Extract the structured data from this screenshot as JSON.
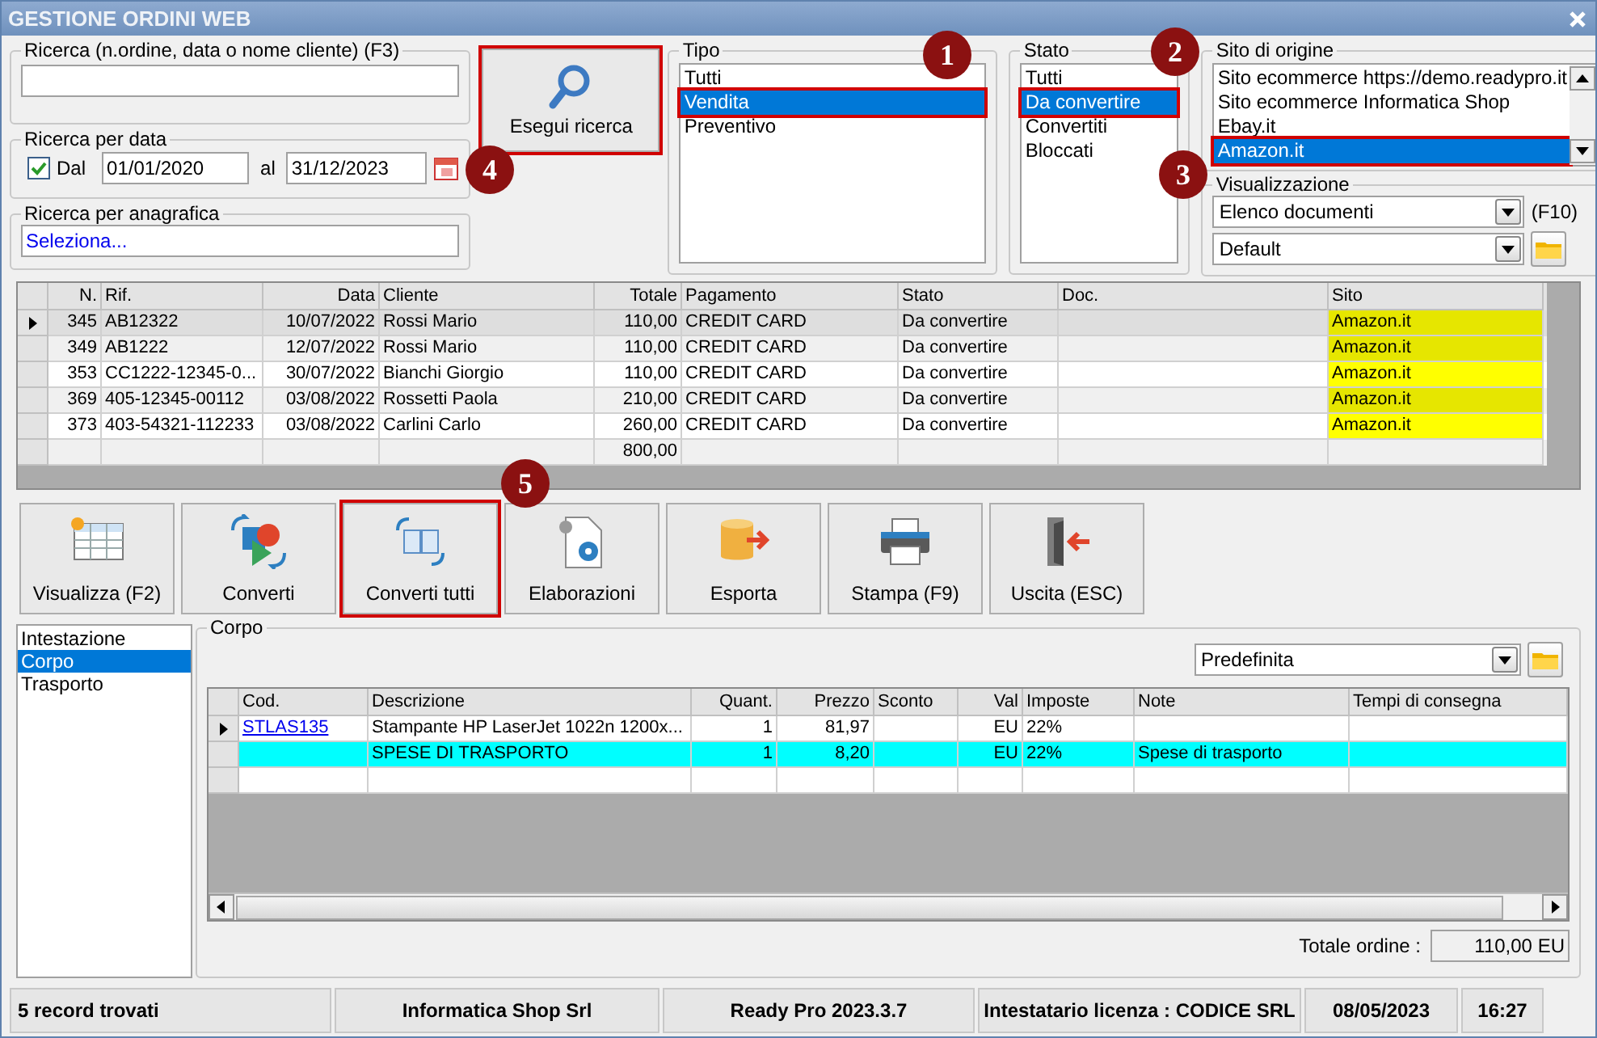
{
  "window": {
    "title": "GESTIONE ORDINI WEB"
  },
  "search": {
    "label": "Ricerca (n.ordine, data o nome cliente) (F3)"
  },
  "date_search": {
    "label": "Ricerca per data",
    "enabled": true,
    "from_label": "Dal",
    "from": "01/01/2020",
    "to_label": "al",
    "to": "31/12/2023"
  },
  "registry_search": {
    "label": "Ricerca per anagrafica",
    "value": "Seleziona..."
  },
  "search_button": {
    "label": "Esegui ricerca",
    "highlighted": true
  },
  "tipo": {
    "label": "Tipo",
    "items": [
      {
        "label": "Tutti",
        "selected": false,
        "highlighted": false
      },
      {
        "label": "Vendita",
        "selected": true,
        "highlighted": true
      },
      {
        "label": "Preventivo",
        "selected": false,
        "highlighted": false
      }
    ]
  },
  "stato": {
    "label": "Stato",
    "items": [
      {
        "label": "Tutti",
        "selected": false,
        "highlighted": false
      },
      {
        "label": "Da convertire",
        "selected": true,
        "highlighted": true
      },
      {
        "label": "Convertiti",
        "selected": false,
        "highlighted": false
      },
      {
        "label": "Bloccati",
        "selected": false,
        "highlighted": false
      }
    ]
  },
  "sito": {
    "label": "Sito di origine",
    "items": [
      {
        "label": "Sito ecommerce https://demo.readypro.it",
        "selected": false,
        "highlighted": false
      },
      {
        "label": "Sito ecommerce Informatica Shop",
        "selected": false,
        "highlighted": false
      },
      {
        "label": "Ebay.it",
        "selected": false,
        "highlighted": false
      },
      {
        "label": "Amazon.it",
        "selected": true,
        "highlighted": true
      }
    ]
  },
  "visualizzazione": {
    "label": "Visualizzazione",
    "view": "Elenco documenti",
    "shortcut": "(F10)",
    "layout": "Default"
  },
  "orders": {
    "columns": [
      "N.",
      "Rif.",
      "Data",
      "Cliente",
      "Totale",
      "Pagamento",
      "Stato",
      "Doc.",
      "Sito"
    ],
    "rows": [
      {
        "cells": [
          "345",
          "AB12322",
          "10/07/2022",
          "Rossi Mario",
          "110,00",
          "CREDIT CARD",
          "Da convertire",
          "",
          "Amazon.it"
        ],
        "current": true
      },
      {
        "cells": [
          "349",
          "AB1222",
          "12/07/2022",
          "Rossi Mario",
          "110,00",
          "CREDIT CARD",
          "Da convertire",
          "",
          "Amazon.it"
        ],
        "current": false
      },
      {
        "cells": [
          "353",
          "CC1222-12345-0...",
          "30/07/2022",
          "Bianchi Giorgio",
          "110,00",
          "CREDIT CARD",
          "Da convertire",
          "",
          "Amazon.it"
        ],
        "current": false
      },
      {
        "cells": [
          "369",
          "405-12345-00112",
          "03/08/2022",
          "Rossetti Paola",
          "210,00",
          "CREDIT CARD",
          "Da convertire",
          "",
          "Amazon.it"
        ],
        "current": false
      },
      {
        "cells": [
          "373",
          "403-54321-112233",
          "03/08/2022",
          "Carlini Carlo",
          "260,00",
          "CREDIT CARD",
          "Da convertire",
          "",
          "Amazon.it"
        ],
        "current": false
      }
    ],
    "total": "800,00"
  },
  "toolbar": [
    {
      "label": "Visualizza (F2)",
      "kind": "view",
      "highlighted": false
    },
    {
      "label": "Converti",
      "kind": "convert",
      "highlighted": false
    },
    {
      "label": "Converti tutti",
      "kind": "convert_all",
      "highlighted": true
    },
    {
      "label": "Elaborazioni",
      "kind": "process",
      "highlighted": false
    },
    {
      "label": "Esporta",
      "kind": "export",
      "highlighted": false
    },
    {
      "label": "Stampa (F9)",
      "kind": "print",
      "highlighted": false
    },
    {
      "label": "Uscita (ESC)",
      "kind": "exit",
      "highlighted": false
    }
  ],
  "sections": [
    {
      "label": "Intestazione",
      "selected": false
    },
    {
      "label": "Corpo",
      "selected": true
    },
    {
      "label": "Trasporto",
      "selected": false
    }
  ],
  "corpo": {
    "label": "Corpo",
    "layout": "Predefinita",
    "columns": [
      "Cod.",
      "Descrizione",
      "Quant.",
      "Prezzo",
      "Sconto",
      "Val",
      "Imposte",
      "Note",
      "Tempi di consegna"
    ],
    "rows": [
      {
        "cells": [
          "STLAS135",
          "Stampante HP LaserJet 1022n 1200x...",
          "1",
          "81,97",
          "",
          "EU",
          "22%",
          "",
          ""
        ],
        "current": true,
        "highlighted": false
      },
      {
        "cells": [
          "",
          "SPESE DI TRASPORTO",
          "1",
          "8,20",
          "",
          "EU",
          "22%",
          "Spese di trasporto",
          ""
        ],
        "current": false,
        "highlighted": true
      }
    ],
    "total_label": "Totale ordine :",
    "total": "110,00 EU"
  },
  "status_bar": [
    "5 record trovati",
    "Informatica Shop Srl",
    "Ready Pro 2023.3.7",
    "Intestatario licenza : CODICE SRL",
    "08/05/2023",
    "16:27"
  ],
  "callouts": [
    {
      "label": "1"
    },
    {
      "label": "2"
    },
    {
      "label": "3"
    },
    {
      "label": "4"
    },
    {
      "label": "5"
    }
  ]
}
